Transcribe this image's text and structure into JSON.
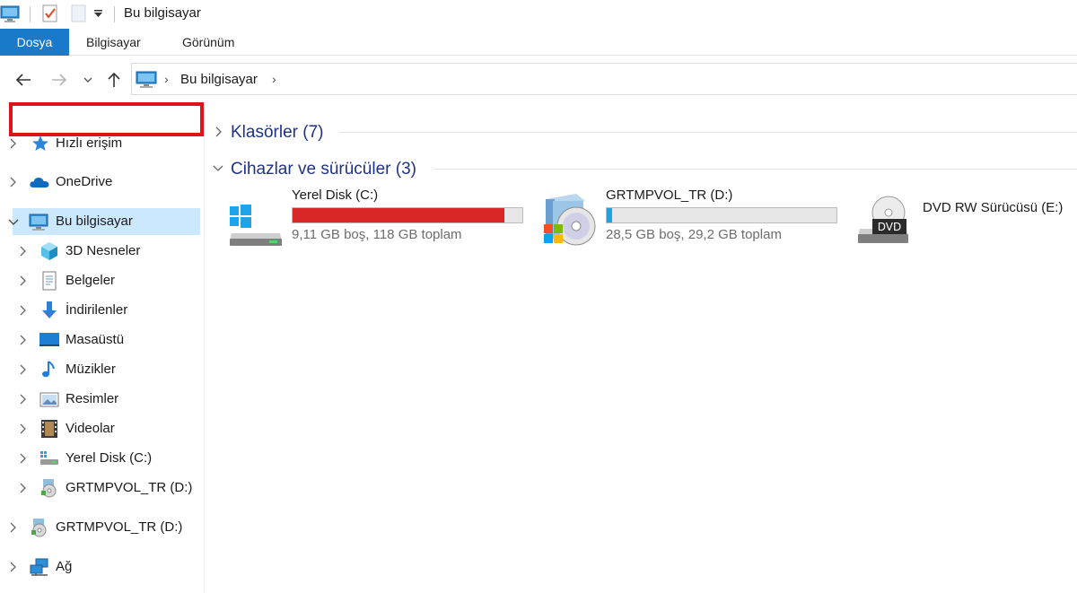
{
  "window": {
    "title": "Bu bilgisayar"
  },
  "ribbon": {
    "tabs": [
      {
        "label": "Dosya",
        "active": true
      },
      {
        "label": "Bilgisayar"
      },
      {
        "label": "Görünüm"
      }
    ]
  },
  "address": {
    "path": "Bu bilgisayar"
  },
  "sidebar": {
    "items": [
      {
        "label": "Hızlı erişim",
        "icon": "star-icon"
      },
      {
        "label": "OneDrive",
        "icon": "cloud-icon"
      },
      {
        "label": "Bu bilgisayar",
        "icon": "monitor-icon",
        "selected": true,
        "expanded": true
      },
      {
        "label": "3D Nesneler",
        "icon": "cube-icon"
      },
      {
        "label": "Belgeler",
        "icon": "document-icon"
      },
      {
        "label": "İndirilenler",
        "icon": "download-arrow-icon"
      },
      {
        "label": "Masaüstü",
        "icon": "desktop-icon"
      },
      {
        "label": "Müzikler",
        "icon": "music-note-icon"
      },
      {
        "label": "Resimler",
        "icon": "picture-icon"
      },
      {
        "label": "Videolar",
        "icon": "film-icon"
      },
      {
        "label": "Yerel Disk (C:)",
        "icon": "hard-drive-icon"
      },
      {
        "label": "GRTMPVOL_TR (D:)",
        "icon": "setup-disc-icon"
      },
      {
        "label": "GRTMPVOL_TR (D:)",
        "icon": "setup-disc-icon"
      },
      {
        "label": "Ağ",
        "icon": "network-icon"
      }
    ]
  },
  "groups": {
    "folders": {
      "title": "Klasörler (7)",
      "collapsed": true
    },
    "devices": {
      "title": "Cihazlar ve sürücüler (3)",
      "collapsed": false
    }
  },
  "drives": [
    {
      "name": "Yerel Disk (C:)",
      "info": "9,11 GB boş, 118 GB toplam",
      "used_fraction": 0.923,
      "bar_color": "#da2626",
      "icon": "windows-drive-icon"
    },
    {
      "name": "GRTMPVOL_TR (D:)",
      "info": "28,5 GB boş, 29,2 GB toplam",
      "used_fraction": 0.024,
      "bar_color": "#26a0da",
      "icon": "setup-disc-icon"
    },
    {
      "name": "DVD RW Sürücüsü (E:)",
      "icon": "dvd-drive-icon",
      "icon_text": "DVD"
    }
  ],
  "colors": {
    "accent": "#1979ca",
    "group_title": "#1e3287",
    "selection": "#cce8ff",
    "highlight": "#e0121c"
  }
}
